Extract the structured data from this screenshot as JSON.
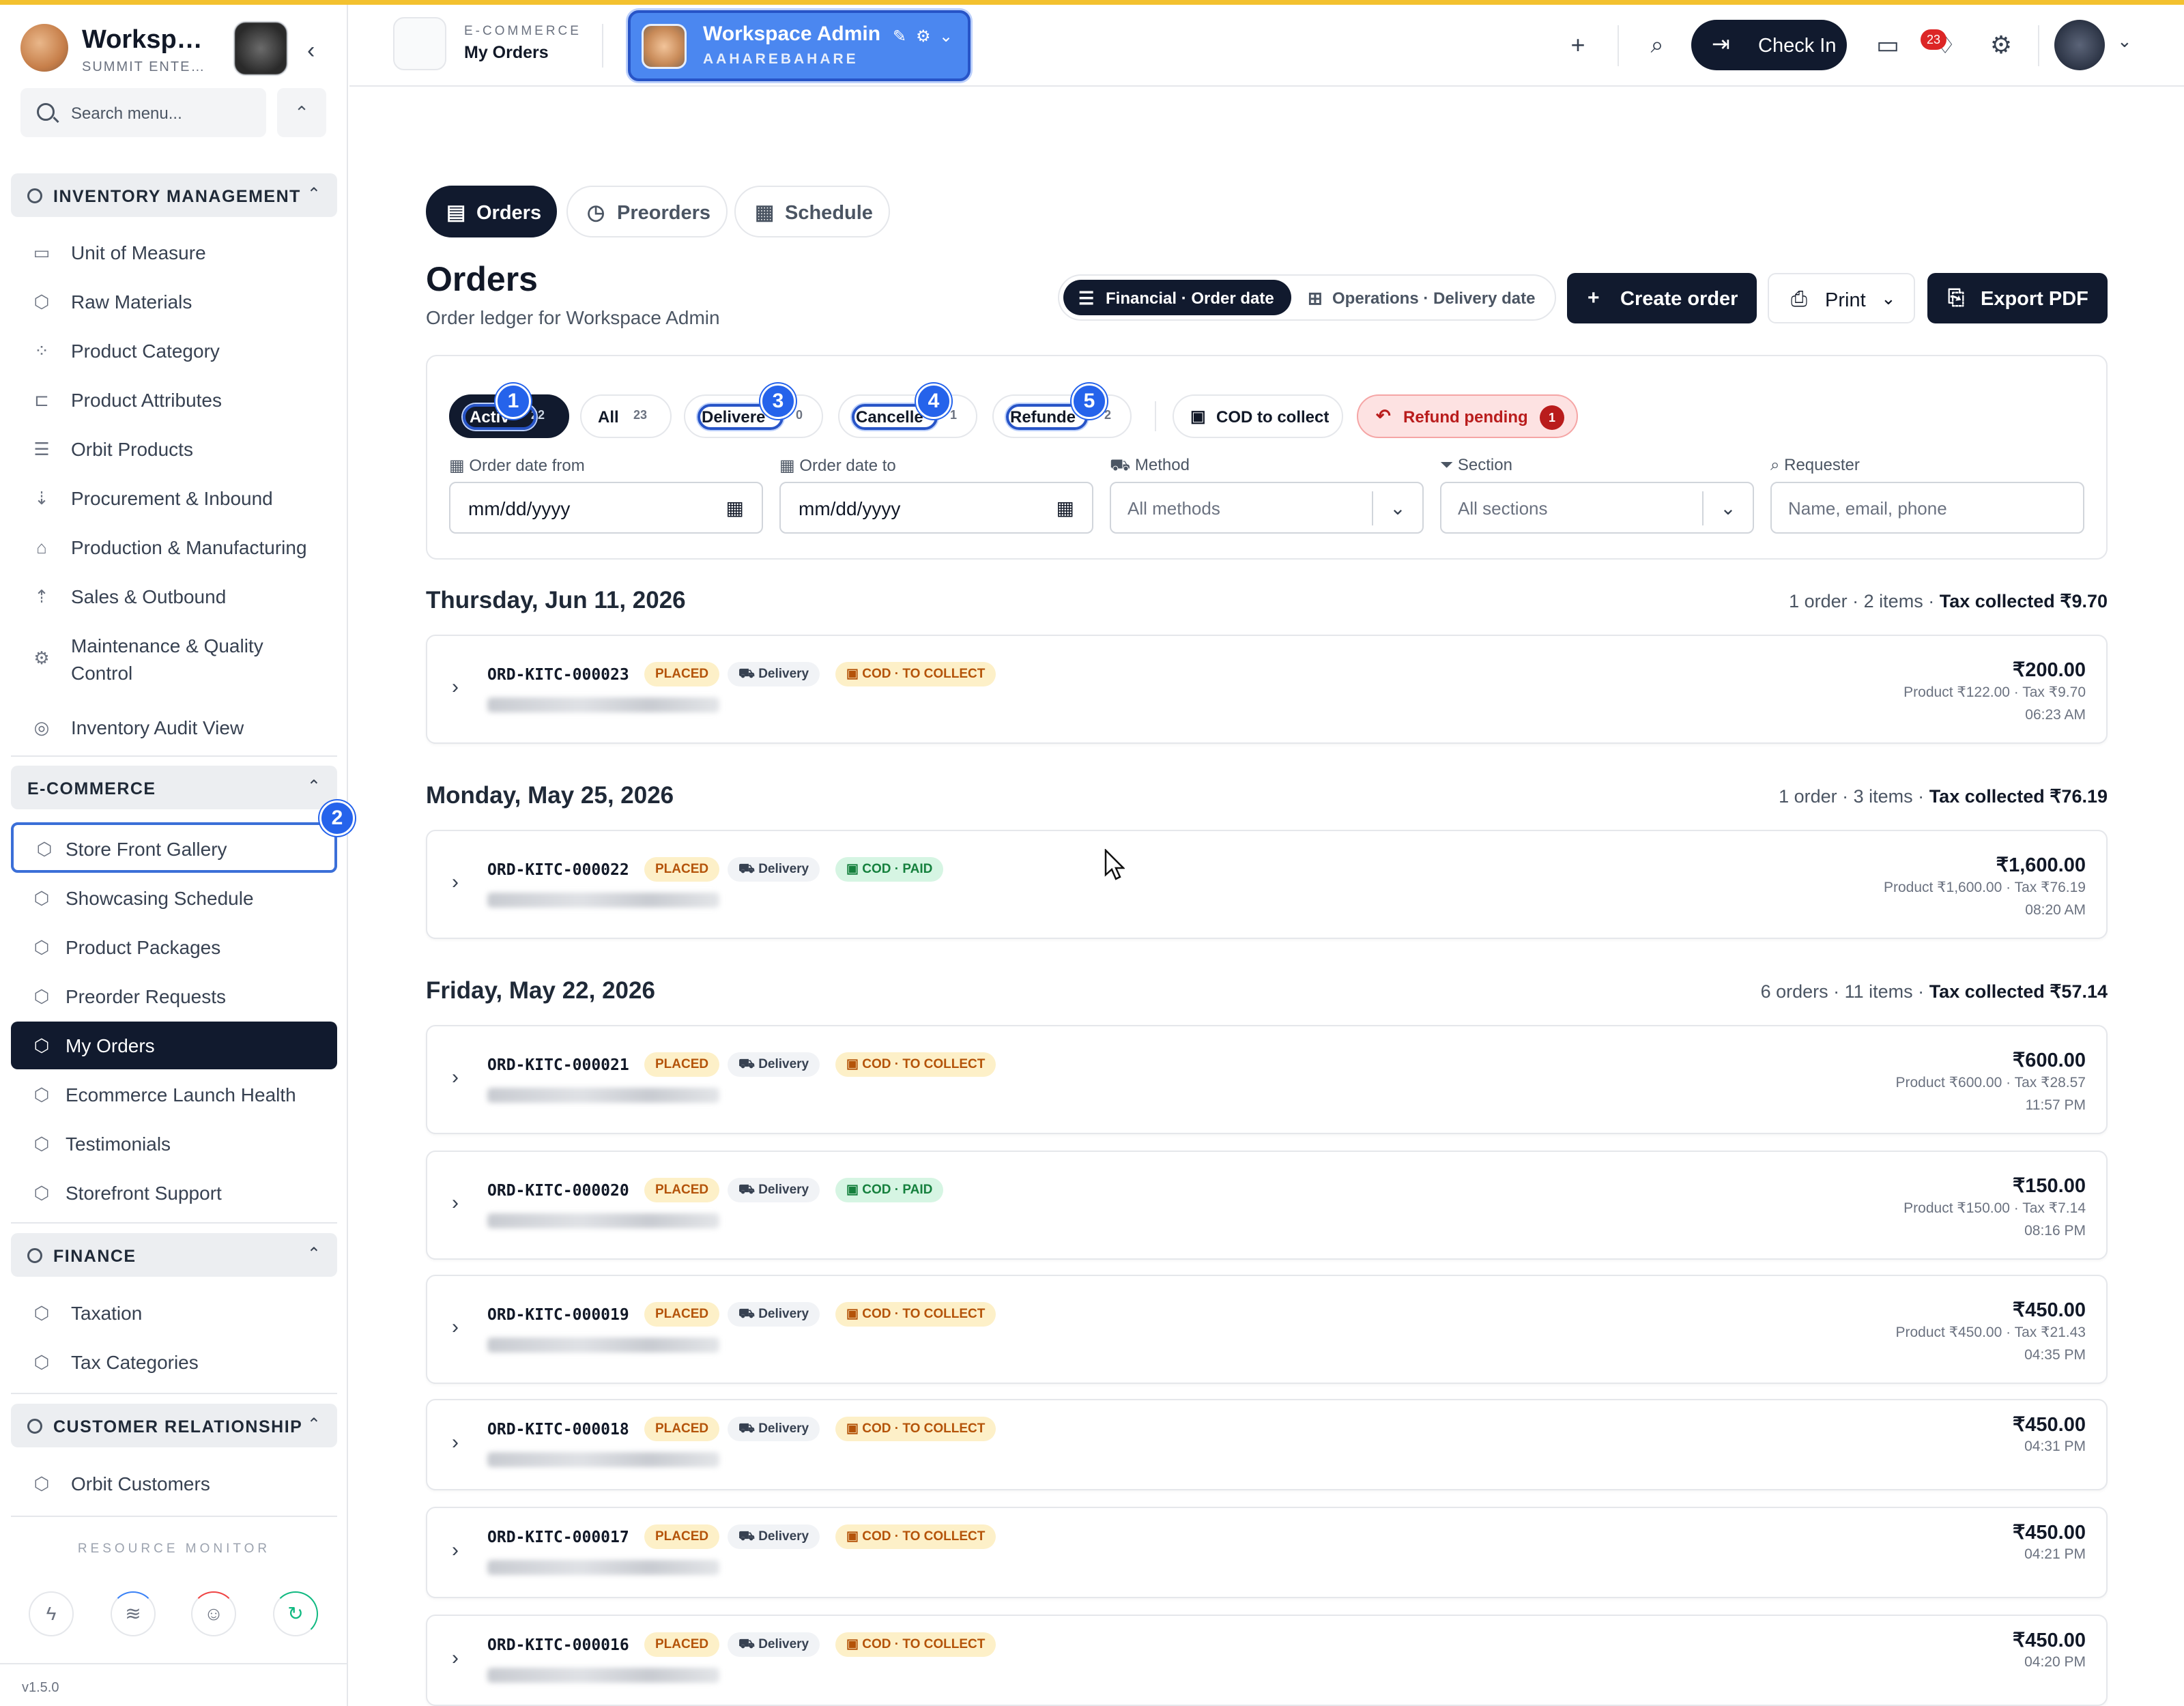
{
  "brand": {
    "title": "Worksp…",
    "subtitle": "SUMMIT ENTE…"
  },
  "sidebar": {
    "search_placeholder": "Search menu...",
    "sections": [
      {
        "label": "INVENTORY MANAGEMENT",
        "items": [
          "Unit of Measure",
          "Raw Materials",
          "Product Category",
          "Product Attributes",
          "Orbit Products",
          "Procurement & Inbound",
          "Production & Manufacturing",
          "Sales & Outbound",
          "Maintenance & Quality",
          "Control",
          "Inventory Audit View"
        ]
      },
      {
        "label": "E-COMMERCE",
        "items": [
          "Store Front Gallery",
          "Showcasing Schedule",
          "Product Packages",
          "Preorder Requests",
          "My Orders",
          "Ecommerce Launch Health",
          "Testimonials",
          "Storefront Support"
        ]
      },
      {
        "label": "FINANCE",
        "items": [
          "Taxation",
          "Tax Categories"
        ]
      },
      {
        "label": "CUSTOMER RELATIONSHIP",
        "items": [
          "Orbit Customers"
        ]
      }
    ],
    "resource_monitor": "RESOURCE MONITOR",
    "version": "v1.5.0"
  },
  "header": {
    "kicker": "E-COMMERCE",
    "title": "My Orders",
    "workspace_name": "Workspace Admin",
    "workspace_sub": "AAHAREBAHARE",
    "checkin": "Check In",
    "notif_count": "23"
  },
  "tabs": [
    "Orders",
    "Preorders",
    "Schedule"
  ],
  "page": {
    "title": "Orders",
    "subtitle": "Order ledger for Workspace Admin"
  },
  "view_toggle": {
    "financial": "Financial · Order date",
    "operations": "Operations · Delivery date"
  },
  "actions": {
    "create": "Create order",
    "print": "Print",
    "export": "Export PDF"
  },
  "chips": [
    {
      "label": "Activ",
      "count": "22"
    },
    {
      "label": "All",
      "count": "23"
    },
    {
      "label": "Delivere",
      "count": "0"
    },
    {
      "label": "Cancelle",
      "count": "1"
    },
    {
      "label": "Refunde",
      "count": "2"
    },
    {
      "label": "COD to collect"
    },
    {
      "label": "Refund pending",
      "count": "1"
    }
  ],
  "badges": [
    "1",
    "2",
    "3",
    "4",
    "5"
  ],
  "filters": {
    "date_from_label": "Order date from",
    "date_from_value": "mm/dd/yyyy",
    "date_to_label": "Order date to",
    "date_to_value": "mm/dd/yyyy",
    "method_label": "Method",
    "method_value": "All methods",
    "section_label": "Section",
    "section_value": "All sections",
    "requester_label": "Requester",
    "requester_placeholder": "Name, email, phone"
  },
  "groups": [
    {
      "date": "Thursday, Jun 11, 2026",
      "summary": "1 order · 2 items ·",
      "tax": "Tax collected ₹9.70",
      "orders": [
        {
          "id": "ORD-KITC-000023",
          "status": "PLACED",
          "method": "Delivery",
          "cod": "COD · TO COLLECT",
          "amount": "₹200.00",
          "breakdown": "Product ₹122.00 · Tax ₹9.70",
          "time": "06:23 AM"
        }
      ]
    },
    {
      "date": "Monday, May 25, 2026",
      "summary": "1 order · 3 items ·",
      "tax": "Tax collected ₹76.19",
      "orders": [
        {
          "id": "ORD-KITC-000022",
          "status": "PLACED",
          "method": "Delivery",
          "cod": "COD · PAID",
          "amount": "₹1,600.00",
          "breakdown": "Product ₹1,600.00 · Tax ₹76.19",
          "time": "08:20 AM"
        }
      ]
    },
    {
      "date": "Friday, May 22, 2026",
      "summary": "6 orders · 11 items ·",
      "tax": "Tax collected ₹57.14",
      "orders": [
        {
          "id": "ORD-KITC-000021",
          "status": "PLACED",
          "method": "Delivery",
          "cod": "COD · TO COLLECT",
          "amount": "₹600.00",
          "breakdown": "Product ₹600.00 · Tax ₹28.57",
          "time": "11:57 PM"
        },
        {
          "id": "ORD-KITC-000020",
          "status": "PLACED",
          "method": "Delivery",
          "cod": "COD · PAID",
          "amount": "₹150.00",
          "breakdown": "Product ₹150.00 · Tax ₹7.14",
          "time": "08:16 PM"
        },
        {
          "id": "ORD-KITC-000019",
          "status": "PLACED",
          "method": "Delivery",
          "cod": "COD · TO COLLECT",
          "amount": "₹450.00",
          "breakdown": "Product ₹450.00 · Tax ₹21.43",
          "time": "04:35 PM"
        },
        {
          "id": "ORD-KITC-000018",
          "status": "PLACED",
          "method": "Delivery",
          "cod": "COD · TO COLLECT",
          "amount": "₹450.00",
          "time": "04:31 PM"
        },
        {
          "id": "ORD-KITC-000017",
          "status": "PLACED",
          "method": "Delivery",
          "cod": "COD · TO COLLECT",
          "amount": "₹450.00",
          "time": "04:21 PM"
        },
        {
          "id": "ORD-KITC-000016",
          "status": "PLACED",
          "method": "Delivery",
          "cod": "COD · TO COLLECT",
          "amount": "₹450.00",
          "time": "04:20 PM"
        }
      ]
    }
  ],
  "colors": {
    "accent": "#111a2e",
    "focus": "#2754c7",
    "badge": "#2563eb",
    "top_bar": "#f3c12f",
    "refund": "#b91c1c"
  }
}
